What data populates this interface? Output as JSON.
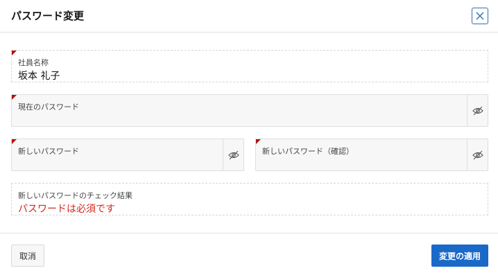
{
  "dialog": {
    "title": "パスワード変更",
    "close_icon": "close-icon"
  },
  "fields": {
    "employee_name": {
      "label": "社員名称",
      "value": "坂本 礼子",
      "required": true
    },
    "current_password": {
      "label": "現在のパスワード",
      "value": "",
      "required": true,
      "toggle_icon": "eye-slash-icon"
    },
    "new_password": {
      "label": "新しいパスワード",
      "value": "",
      "required": true,
      "toggle_icon": "eye-slash-icon"
    },
    "new_password_confirm": {
      "label": "新しいパスワード（確認）",
      "value": "",
      "required": true,
      "toggle_icon": "eye-slash-icon"
    },
    "check_result": {
      "label": "新しいパスワードのチェック結果",
      "value": "パスワードは必須です"
    }
  },
  "footer": {
    "cancel_label": "取消",
    "apply_label": "変更の適用"
  },
  "colors": {
    "primary": "#1a68c8",
    "required_marker": "#b01010",
    "error_text": "#d0281e"
  }
}
